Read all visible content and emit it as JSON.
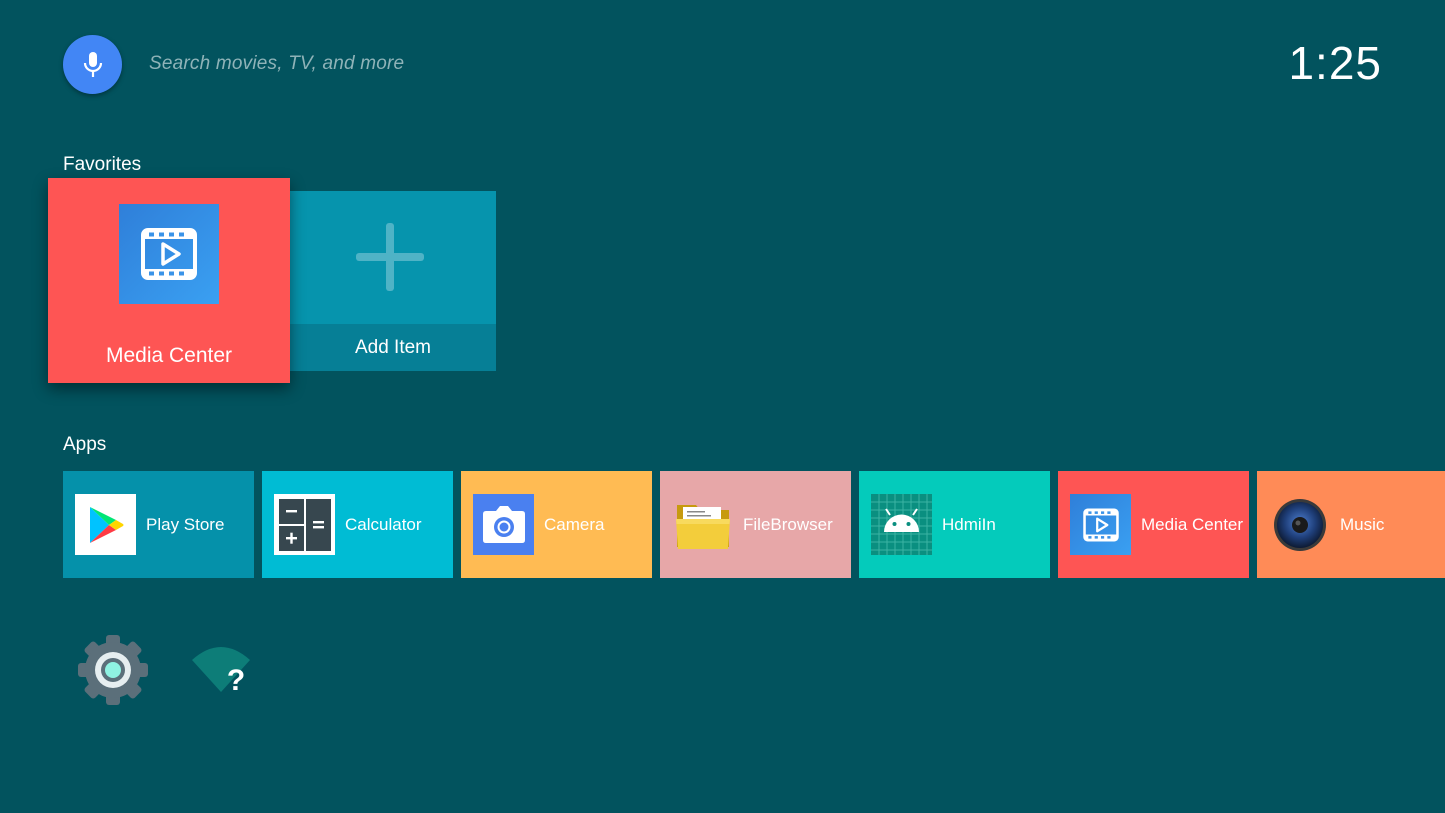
{
  "search": {
    "hint": "Search movies, TV, and more",
    "mic_icon": "mic-icon",
    "mic_color": "#4286f5"
  },
  "clock": {
    "time": "1:25"
  },
  "favorites": {
    "title": "Favorites",
    "items": [
      {
        "label": "Media Center",
        "icon": "video-play-icon",
        "color": "#fe5554"
      },
      {
        "label": "Add Item",
        "icon": "plus-icon",
        "color": "#0694ad"
      }
    ]
  },
  "apps": {
    "title": "Apps",
    "items": [
      {
        "label": "Play Store",
        "icon": "play-store-icon",
        "color": "#0591aa"
      },
      {
        "label": "Calculator",
        "icon": "calculator-icon",
        "color": "#00bcd4"
      },
      {
        "label": "Camera",
        "icon": "camera-icon",
        "color": "#ffbb53"
      },
      {
        "label": "FileBrowser",
        "icon": "folder-icon",
        "color": "#e7a7a8"
      },
      {
        "label": "HdmiIn",
        "icon": "android-icon",
        "color": "#04cbbb"
      },
      {
        "label": "Media Center",
        "icon": "video-play-icon",
        "color": "#fe5554"
      },
      {
        "label": "Music",
        "icon": "speaker-icon",
        "color": "#ff8b57"
      }
    ]
  },
  "bottom": {
    "settings_icon": "gear-icon",
    "network_icon": "wifi-unknown-icon"
  },
  "colors": {
    "background": "#02535e"
  }
}
